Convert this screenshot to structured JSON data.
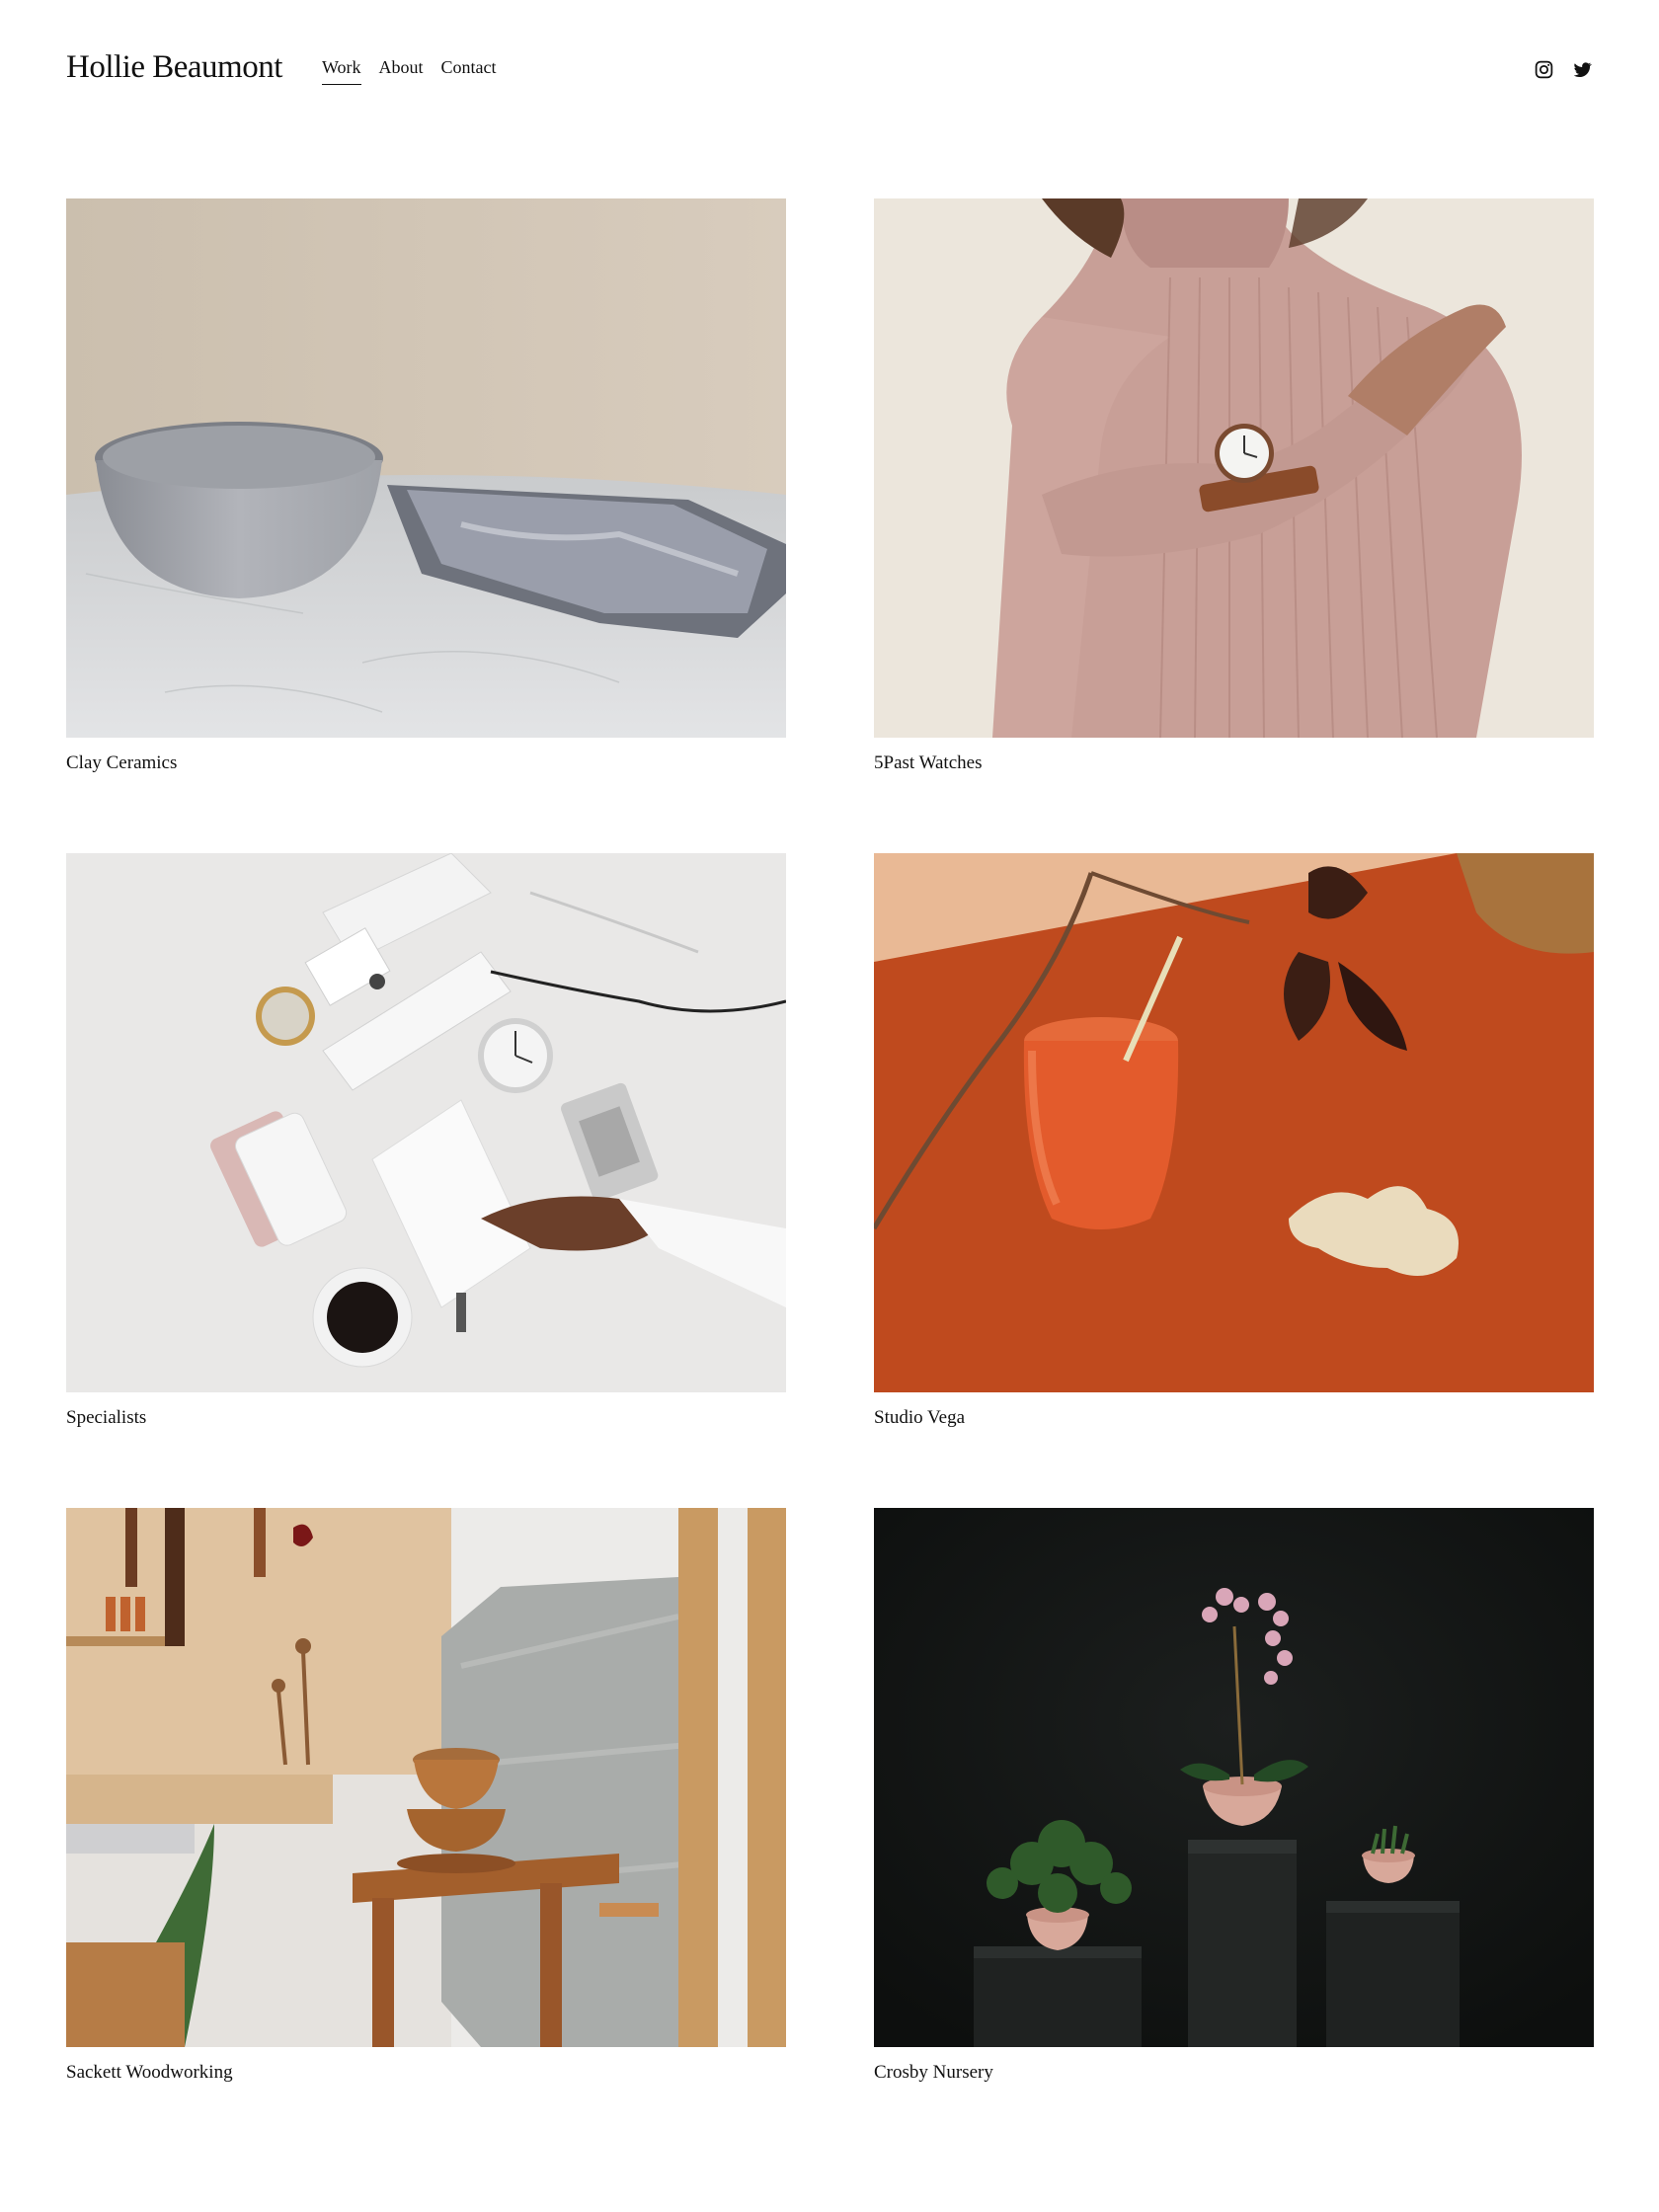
{
  "header": {
    "site_title": "Hollie Beaumont",
    "nav": [
      {
        "label": "Work",
        "active": true
      },
      {
        "label": "About",
        "active": false
      },
      {
        "label": "Contact",
        "active": false
      }
    ],
    "social": [
      {
        "icon": "instagram-icon"
      },
      {
        "icon": "twitter-icon"
      }
    ]
  },
  "projects": [
    {
      "title": "Clay Ceramics",
      "image": "grey ceramic bowl and marbled tray on a marble table"
    },
    {
      "title": "5Past Watches",
      "image": "woman in pink ribbed turtleneck wearing a leather-strap watch"
    },
    {
      "title": "Specialists",
      "image": "overhead desk flat lay with clock, calculator, coffee and hand writing"
    },
    {
      "title": "Studio Vega",
      "image": "glass of orange juice with straw, ginger and branch on orange cloth"
    },
    {
      "title": "Sackett Woodworking",
      "image": "woodworking tools on a pegboard with wooden bowls on a workbench"
    },
    {
      "title": "Crosby Nursery",
      "image": "potted orchid and plants on black plinths against a dark background"
    }
  ],
  "colors": {
    "text": "#111111",
    "background": "#ffffff"
  }
}
